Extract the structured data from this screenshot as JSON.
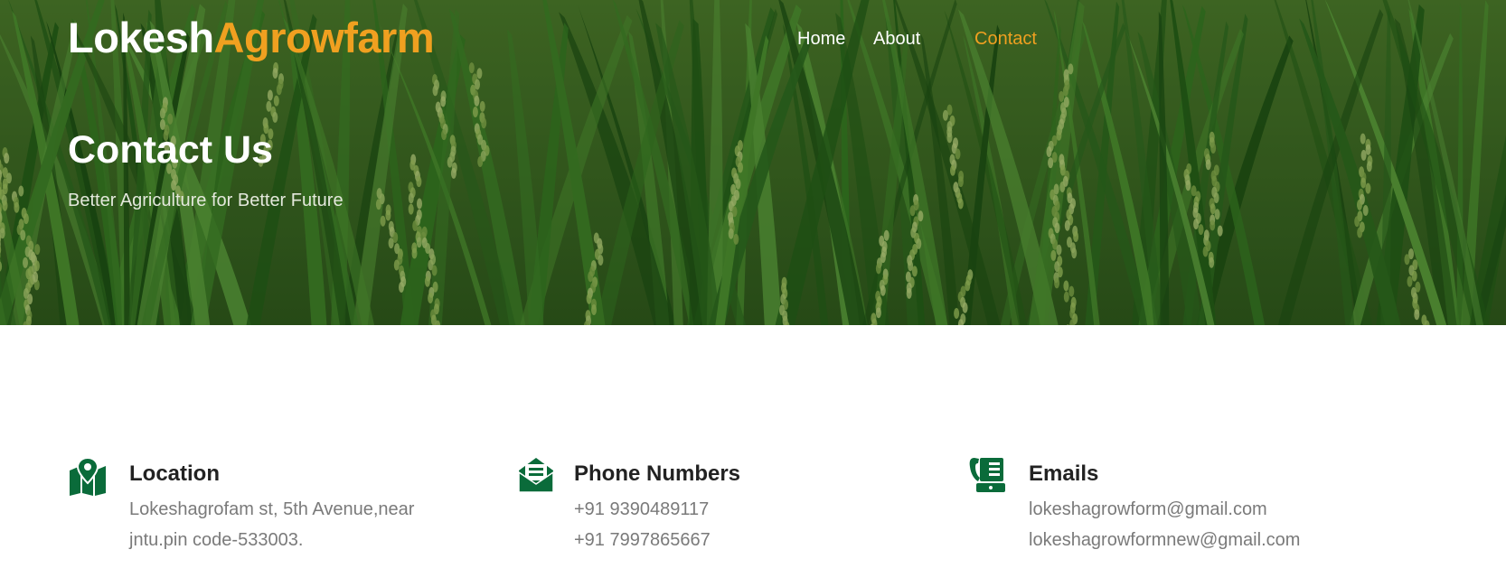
{
  "brand": {
    "part1": "Lokesh",
    "part2": "Agrowfarm"
  },
  "nav": {
    "items": [
      "Home",
      "About",
      "Contact"
    ],
    "active": "Contact"
  },
  "hero": {
    "title": "Contact Us",
    "subtitle": "Better Agriculture for Better Future"
  },
  "contact": {
    "location": {
      "icon": "map-pin-icon",
      "title": "Location",
      "lines": [
        "Lokeshagrofam st, 5th Avenue,near",
        "jntu.pin code-533003."
      ]
    },
    "phone": {
      "icon": "envelope-icon",
      "title": "Phone Numbers",
      "lines": [
        "+91 9390489117",
        "+91 7997865667"
      ]
    },
    "email": {
      "icon": "fax-icon",
      "title": "Emails",
      "lines": [
        "lokeshagrowform@gmail.com",
        "lokeshagrowformnew@gmail.com"
      ]
    }
  },
  "colors": {
    "accent": "#f0a020",
    "icon_green": "#0a6b3a",
    "hero_green": "#3e6a22",
    "text_grey": "#7a7a7a"
  }
}
